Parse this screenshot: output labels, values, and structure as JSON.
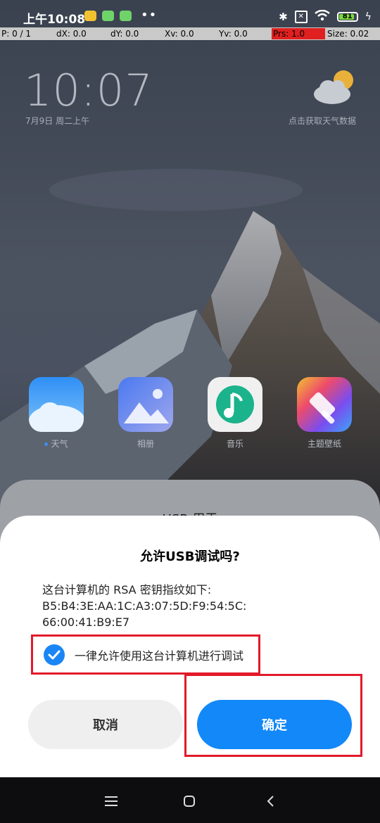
{
  "status_bar": {
    "time": "上午10:08",
    "battery": "81",
    "icons": [
      "taxi-icon",
      "android-icon",
      "android-icon",
      "more-dots-icon",
      "bluetooth-icon",
      "no-sim-icon",
      "wifi-icon",
      "battery-icon",
      "charging-icon"
    ]
  },
  "pointer_bar": {
    "p": "P: 0 / 1",
    "dx": "dX: 0.0",
    "dy": "dY: 0.0",
    "xv": "Xv: 0.0",
    "yv": "Yv: 0.0",
    "prs": "Prs: 1.0",
    "size": "Size: 0.02"
  },
  "lockscreen": {
    "clock": "10:07",
    "date": "7月9日 周二上午",
    "weather_hint": "点击获取天气数据"
  },
  "apps": [
    {
      "label": "天气",
      "icon": "weather-app-icon"
    },
    {
      "label": "相册",
      "icon": "gallery-app-icon"
    },
    {
      "label": "音乐",
      "icon": "music-app-icon"
    },
    {
      "label": "主题壁纸",
      "icon": "themes-app-icon"
    }
  ],
  "back_sheet": {
    "title": "USB 用于"
  },
  "dialog": {
    "title": "允许USB调试吗?",
    "body": "这台计算机的 RSA 密钥指纹如下:\nB5:B4:3E:AA:1C:A3:07:5D:F9:54:5C:\n66:00:41:B9:E7",
    "checkbox_label": "一律允许使用这台计算机进行调试",
    "checkbox_checked": true,
    "cancel_label": "取消",
    "ok_label": "确定"
  },
  "colors": {
    "accent": "#1288f9",
    "highlight": "#e21a2a"
  }
}
